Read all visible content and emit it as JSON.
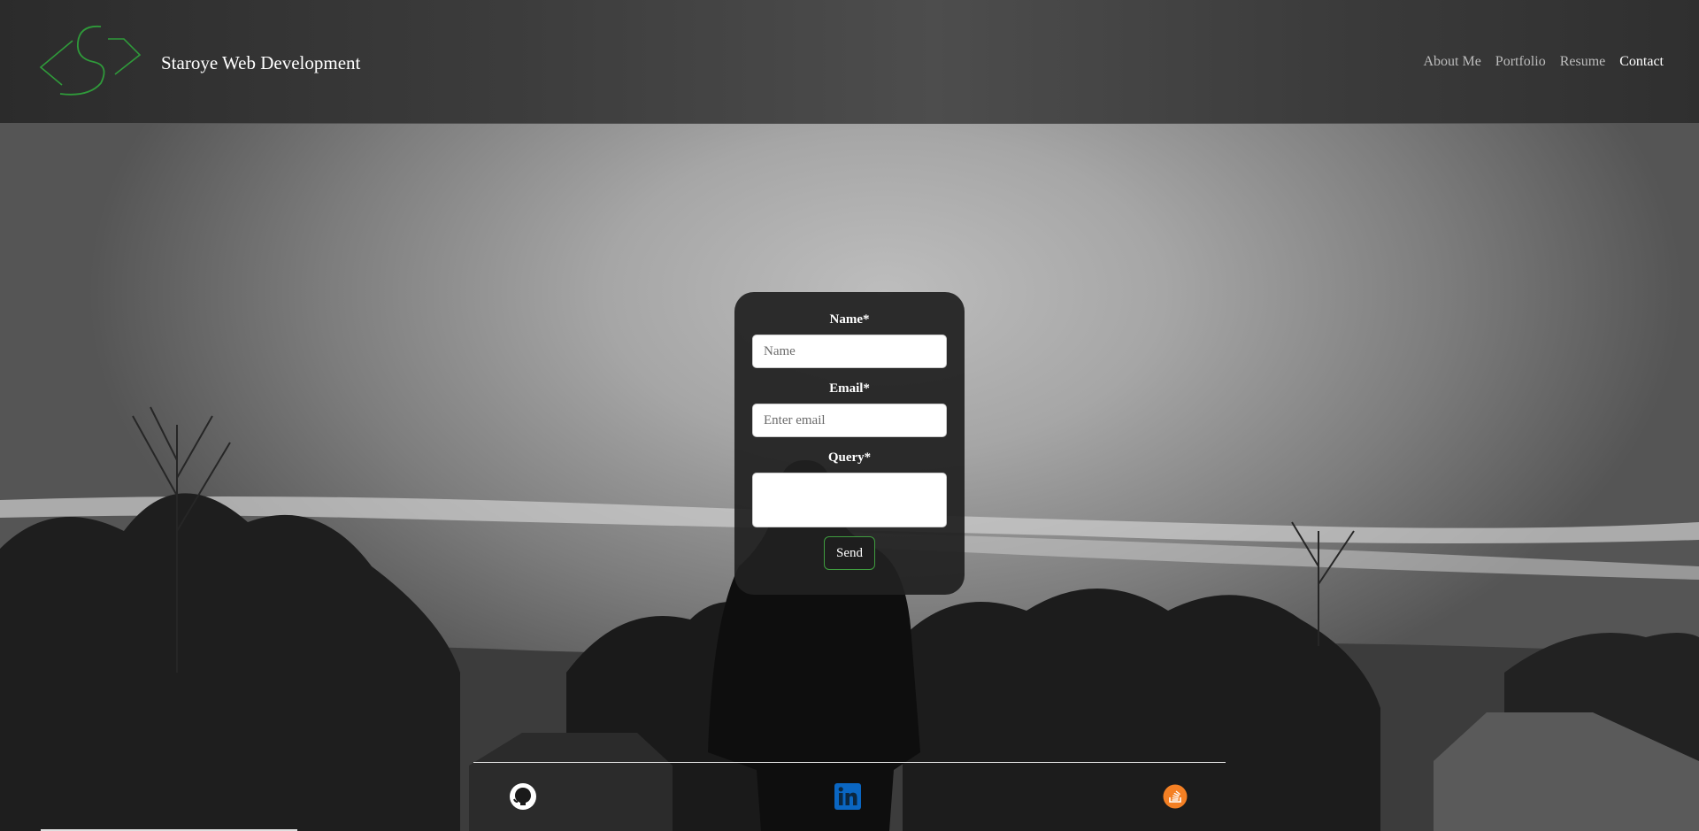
{
  "header": {
    "brand": "Staroye Web Development",
    "logo_icon": "signature-logo-icon",
    "nav": [
      {
        "label": "About Me",
        "active": false
      },
      {
        "label": "Portfolio",
        "active": false
      },
      {
        "label": "Resume",
        "active": false
      },
      {
        "label": "Contact",
        "active": true
      }
    ]
  },
  "form": {
    "name_label": "Name*",
    "name_placeholder": "Name",
    "name_value": "",
    "email_label": "Email*",
    "email_placeholder": "Enter email",
    "email_value": "",
    "query_label": "Query*",
    "query_value": "",
    "send_label": "Send"
  },
  "footer": {
    "socials": [
      {
        "icon": "github-icon"
      },
      {
        "icon": "linkedin-icon"
      },
      {
        "icon": "stackoverflow-icon"
      }
    ]
  },
  "colors": {
    "accent": "#3f9d3f",
    "linkedin": "#0a66c2",
    "stackoverflow": "#f48024",
    "card": "#202020"
  }
}
